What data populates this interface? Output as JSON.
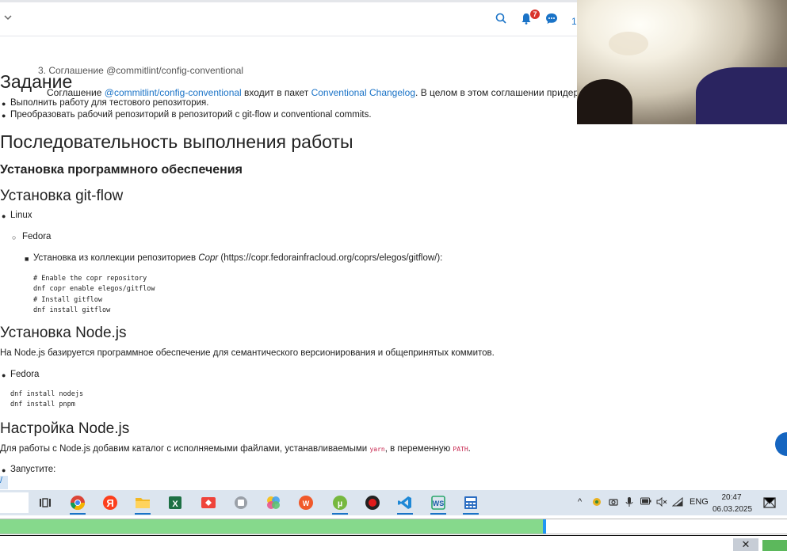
{
  "topbar": {
    "notif_count": "7",
    "num": "1"
  },
  "doc": {
    "cut_line": "3. Соглашение @commitlint/config-conventional",
    "intro_pre": "Соглашение ",
    "intro_link1": "@commitlint/config-conventional",
    "intro_mid": " входит в пакет ",
    "intro_link2": "Conventional Changelog",
    "intro_post": ". В целом в этом соглашении придерживаются",
    "h_task": "Задание",
    "task_items": [
      "Выполнить работу для тестового репозитория.",
      "Преобразовать рабочий репозиторий в репозиторий с git-flow и conventional commits."
    ],
    "h_sequence": "Последовательность выполнения работы",
    "h_install_sw": "Установка программного обеспечения",
    "h_gitflow": "Установка git-flow",
    "li_linux": "Linux",
    "li_fedora": "Fedora",
    "li_copr_pre": "Установка из коллекции репозиториев ",
    "li_copr_em": "Copr",
    "li_copr_post": " (https://copr.fedorainfracloud.org/coprs/elegos/gitflow/):",
    "code_gitflow": [
      "# Enable the copr repository",
      "dnf copr enable elegos/gitflow",
      "# Install gitflow",
      "dnf install gitflow"
    ],
    "h_node": "Установка Node.js",
    "p_node": "На Node.js базируется программное обеспечение для семантического версионирования и общепринятых коммитов.",
    "li_fedora2": "Fedora",
    "code_node": [
      "dnf install nodejs",
      "dnf install pnpm"
    ],
    "h_node_cfg": "Настройка Node.js",
    "p_cfg_pre": "Для работы с Node.js добавим каталог с исполняемыми файлами, устанавливаемыми ",
    "p_cfg_code1": "yarn",
    "p_cfg_mid": ", в переменную ",
    "p_cfg_code2": "PATH",
    "p_cfg_post": ".",
    "li_run": "Запустите:",
    "cut_bottom": "/"
  },
  "taskbar": {
    "apps": [
      "task-view-icon",
      "chrome-icon",
      "yandex-icon",
      "file-explorer-icon",
      "excel-icon",
      "anydesk-icon",
      "app-gray-icon",
      "photos-icon",
      "wps-icon",
      "utorrent-icon",
      "obs-icon",
      "vscode-icon",
      "app-ws-icon",
      "calculator-icon"
    ],
    "lang": "ENG",
    "time": "20:47",
    "date": "06.03.2025"
  },
  "progress": {
    "fraction": 0.69
  }
}
